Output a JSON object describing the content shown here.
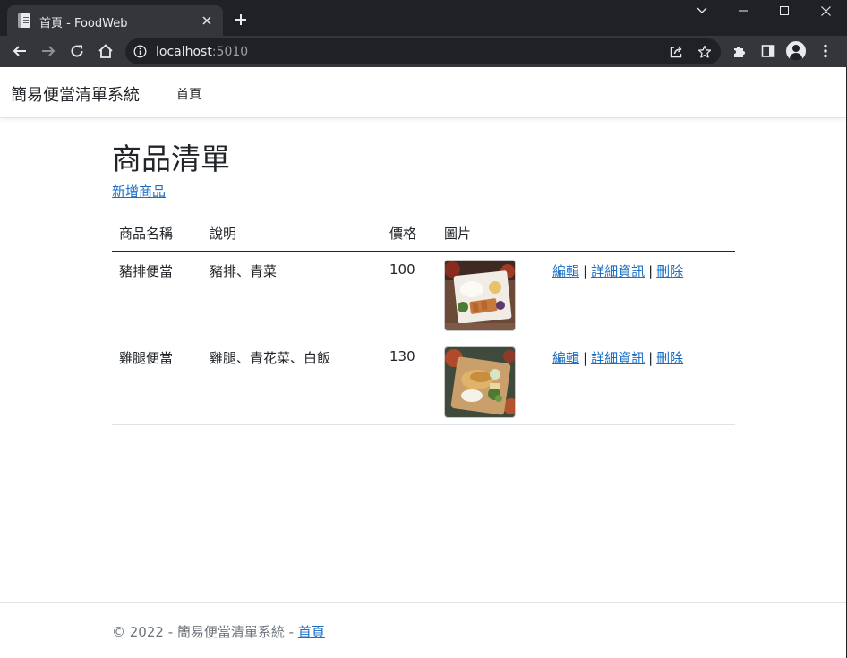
{
  "browser": {
    "tab_title": "首頁 - FoodWeb",
    "url_host": "localhost",
    "url_port": ":5010",
    "icons": {
      "back": "back-arrow-icon",
      "forward": "forward-arrow-icon",
      "reload": "reload-icon",
      "home": "home-icon",
      "info": "info-icon",
      "share": "share-icon",
      "bookmark": "star-icon",
      "extensions": "puzzle-icon",
      "side_panel": "side-panel-icon",
      "profile": "profile-avatar-icon",
      "menu": "kebab-menu-icon"
    }
  },
  "site": {
    "brand": "簡易便當清單系統",
    "nav": [
      {
        "label": "首頁"
      }
    ]
  },
  "main": {
    "title": "商品清單",
    "create_link": "新增商品",
    "columns": [
      "商品名稱",
      "說明",
      "價格",
      "圖片"
    ],
    "rows": [
      {
        "name": "豬排便當",
        "description": "豬排、青菜",
        "price": "100",
        "image": "pork-chop-bento-photo",
        "actions": {
          "edit": "編輯",
          "details": "詳細資訊",
          "delete": "刪除",
          "sep": "|"
        }
      },
      {
        "name": "雞腿便當",
        "description": "雞腿、青花菜、白飯",
        "price": "130",
        "image": "chicken-leg-bento-photo",
        "actions": {
          "edit": "編輯",
          "details": "詳細資訊",
          "delete": "刪除",
          "sep": "|"
        }
      }
    ]
  },
  "footer": {
    "text": "© 2022 - 簡易便當清單系統 - ",
    "link": "首頁"
  },
  "colors": {
    "link": "#1b6ec2",
    "chrome_dark": "#202124",
    "chrome_toolbar": "#35363a"
  }
}
